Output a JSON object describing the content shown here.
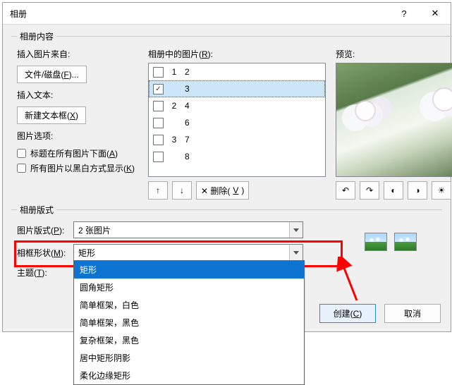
{
  "dialog": {
    "title": "相册",
    "help_symbol": "?",
    "close_symbol": "✕"
  },
  "content": {
    "section_label": "相册内容",
    "insert_from_label": "插入图片来自:",
    "file_button_html": "文件/磁盘(<u>F</u>)...",
    "insert_text_label": "插入文本:",
    "new_textbox_button_html": "新建文本框(<u>X</u>)",
    "options_label": "图片选项:",
    "opt_caption_html": "标题在所有图片下面(<u>A</u>)",
    "opt_bw_html": "所有图片以黑白方式显示(<u>K</u>)",
    "list_label_html": "相册中的图片(<u>R</u>):",
    "items": [
      {
        "checked": false,
        "index": "1",
        "name": "2",
        "selected": false
      },
      {
        "checked": true,
        "index": "",
        "name": "3",
        "selected": true
      },
      {
        "checked": false,
        "index": "2",
        "name": "4",
        "selected": false
      },
      {
        "checked": false,
        "index": "",
        "name": "6",
        "selected": false
      },
      {
        "checked": false,
        "index": "3",
        "name": "7",
        "selected": false
      },
      {
        "checked": false,
        "index": "",
        "name": "8",
        "selected": false
      }
    ],
    "move_up": "↑",
    "move_down": "↓",
    "remove_html": "✕ 删除(<u>V</u>)",
    "preview_label": "预览:"
  },
  "layout": {
    "section_label": "相册版式",
    "pic_layout_label_html": "图片版式(<u>P</u>):",
    "pic_layout_value": "2 张图片",
    "frame_shape_label_html": "相框形状(<u>M</u>):",
    "frame_shape_value": "矩形",
    "frame_options": [
      {
        "label": "矩形",
        "selected": true
      },
      {
        "label": "圆角矩形",
        "selected": false
      },
      {
        "label": "简单框架，白色",
        "selected": false
      },
      {
        "label": "简单框架，黑色",
        "selected": false
      },
      {
        "label": "复杂框架，黑色",
        "selected": false
      },
      {
        "label": "居中矩形阴影",
        "selected": false
      },
      {
        "label": "柔化边缘矩形",
        "selected": false
      }
    ],
    "theme_label_html": "主题(<u>T</u>):"
  },
  "footer": {
    "create_html": "创建(<u>C</u>)",
    "cancel": "取消"
  },
  "icons": {
    "rot_left": "↶",
    "rot_right": "↷",
    "contrast": "◐",
    "brightness": "◑",
    "b_up": "☀",
    "b_down": "✺"
  }
}
